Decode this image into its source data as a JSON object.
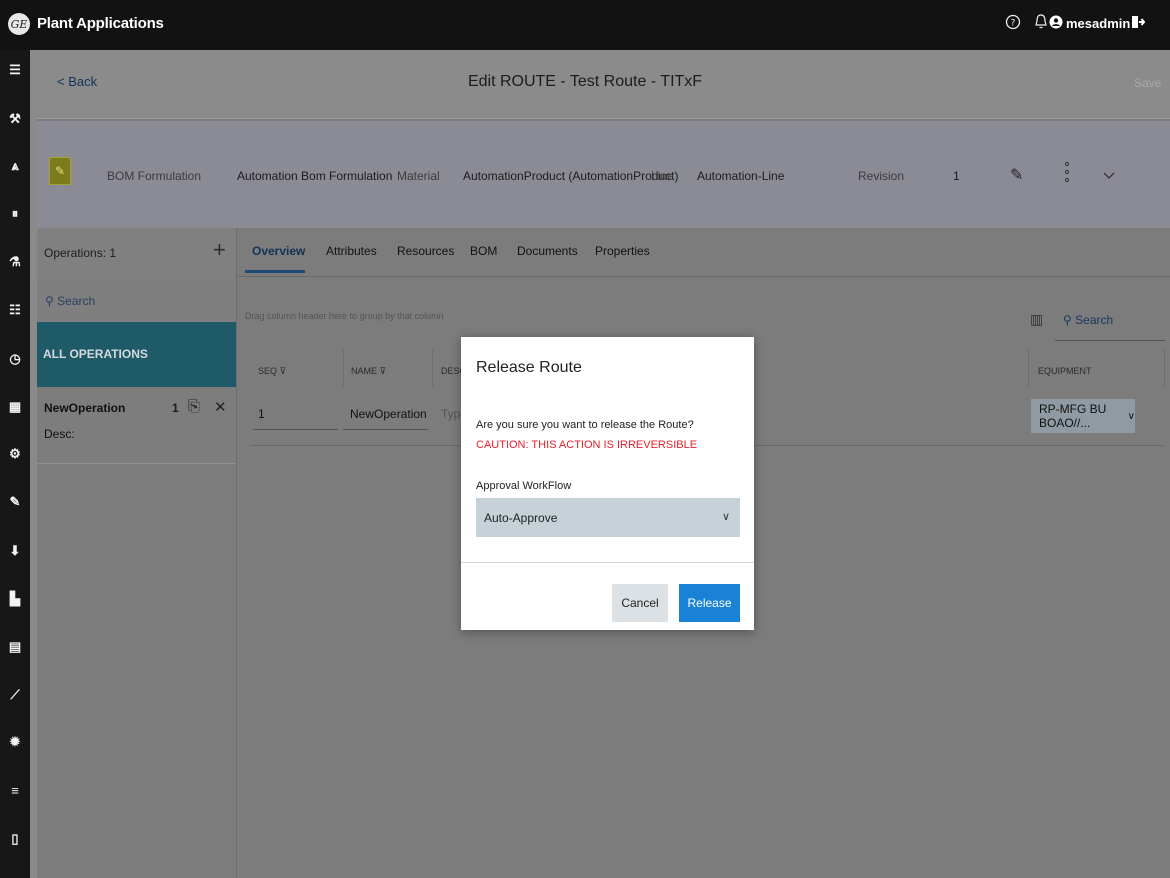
{
  "app": {
    "title": "Plant Applications",
    "logo_text": "GE"
  },
  "topbar": {
    "help_icon": "help-icon",
    "bell_icon": "bell-icon",
    "user_icon": "user-icon",
    "username": "mesadmin",
    "logout_icon": "logout-icon"
  },
  "nav": {
    "icons": [
      "list-icon",
      "wrench-icon",
      "route-icon",
      "pause-icon",
      "flask-icon",
      "checklist-icon",
      "clock-icon",
      "table-icon",
      "settings-grid-icon",
      "edit-icon",
      "download-icon",
      "factory-icon",
      "document-icon",
      "chart-icon",
      "gear-icon",
      "sliders-icon",
      "trash-icon"
    ]
  },
  "header": {
    "back_label": "< Back",
    "title": "Edit ROUTE - Test Route - TITxF",
    "save_label": "Save"
  },
  "info": {
    "bom_formulation_label": "BOM Formulation",
    "bom_formulation_value": "Automation Bom Formulation",
    "material_label": "Material",
    "material_value": "AutomationProduct (AutomationProduct)",
    "line_label": "Line",
    "line_value": "Automation-Line",
    "revision_label": "Revision",
    "revision_value": "1"
  },
  "operations": {
    "header_label": "Operations: 1",
    "search_placeholder": "Search",
    "all_label": "ALL OPERATIONS",
    "items": [
      {
        "name": "NewOperation",
        "desc": "Desc:",
        "count": "1"
      }
    ]
  },
  "tabs": [
    "Overview",
    "Attributes",
    "Resources",
    "BOM",
    "Documents",
    "Properties"
  ],
  "grid": {
    "drag_hint": "Drag column header here to group by that column",
    "search_placeholder": "Search",
    "columns": {
      "seq": "SEQ",
      "name": "NAME",
      "desc": "DESC",
      "equipment": "EQUIPMENT"
    },
    "row": {
      "seq": "1",
      "name": "NewOperation",
      "desc_placeholder": "Type",
      "equipment": "RP-MFG BU BOAO//..."
    }
  },
  "modal": {
    "title": "Release Route",
    "question": "Are you sure you want to release the Route?",
    "warning": "CAUTION: THIS ACTION IS IRREVERSIBLE",
    "workflow_label": "Approval WorkFlow",
    "workflow_value": "Auto-Approve",
    "cancel_label": "Cancel",
    "release_label": "Release"
  },
  "colors": {
    "accent": "#1a82d6",
    "warning": "#e5202b",
    "selected": "#1f5a68"
  }
}
